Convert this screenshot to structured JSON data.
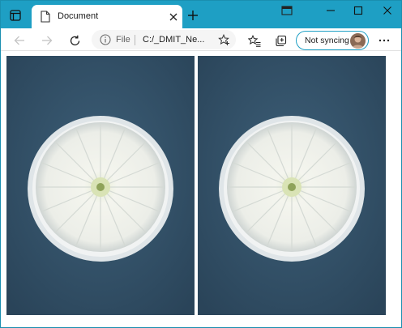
{
  "browser": {
    "tab": {
      "title": "Document",
      "favicon": "document-icon"
    },
    "address": {
      "scheme_label": "File",
      "url": "C:/_DMIT_Ne..."
    },
    "sync": {
      "label": "Not syncing"
    },
    "accent_color": "#1e9fc4"
  },
  "content": {
    "images": [
      {
        "name": "white-chrysanthemum-plate-photo",
        "subject": "white flower in white bowl on blue textile"
      },
      {
        "name": "white-chrysanthemum-plate-photo",
        "subject": "white flower in white bowl on blue textile"
      }
    ]
  }
}
